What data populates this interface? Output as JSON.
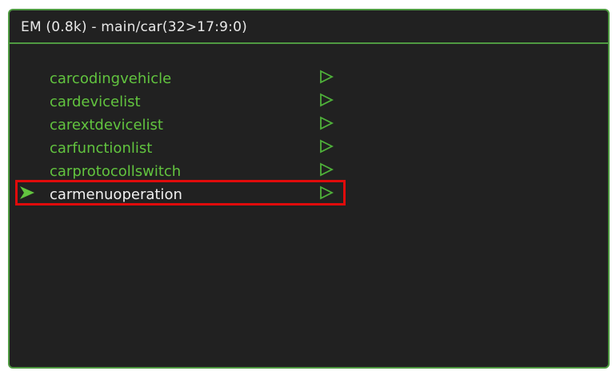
{
  "window": {
    "title": "EM (0.8k) - main/car(32>17:9:0)"
  },
  "menu": {
    "items": [
      {
        "label": "carcodingvehicle",
        "selected": false,
        "icon": "play-arrow-outline-icon"
      },
      {
        "label": "cardevicelist",
        "selected": false,
        "icon": "play-arrow-outline-icon"
      },
      {
        "label": "carextdevicelist",
        "selected": false,
        "icon": "play-arrow-outline-icon"
      },
      {
        "label": "carfunctionlist",
        "selected": false,
        "icon": "play-arrow-outline-icon"
      },
      {
        "label": "carprotocollswitch",
        "selected": false,
        "icon": "play-arrow-outline-icon"
      },
      {
        "label": "carmenuoperation",
        "selected": true,
        "icon": "play-arrow-outline-icon"
      }
    ],
    "cursor_icon": "selection-pointer-icon"
  },
  "colors": {
    "background": "#212121",
    "frame": "#4f9a42",
    "item_text": "#62c43f",
    "selected_text": "#f0f0f0",
    "title_text": "#e9e9e9",
    "highlight_box": "#e00b0b"
  }
}
